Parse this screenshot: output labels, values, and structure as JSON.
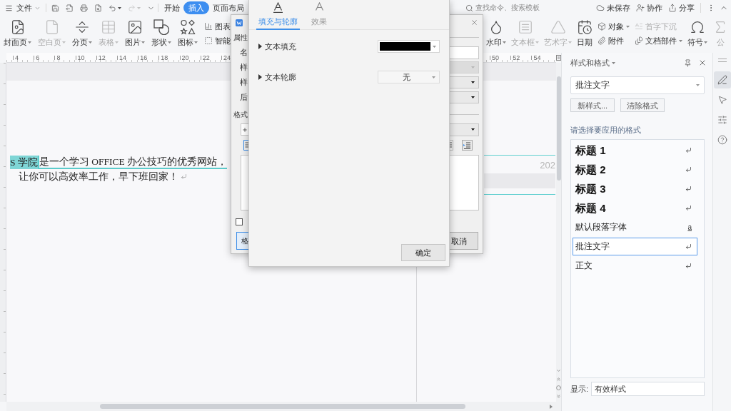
{
  "top_bar": {
    "file_menu": "文件",
    "quick_access": [
      {
        "disabled": false
      },
      {
        "disabled": false
      },
      {
        "disabled": false
      },
      {
        "disabled": false
      },
      {
        "disabled": false
      },
      {
        "disabled": true
      },
      {
        "disabled": false
      }
    ],
    "tabs": [
      {
        "label": "开始",
        "selected": false
      },
      {
        "label": "插入",
        "selected": true
      },
      {
        "label": "页面布局",
        "selected": false
      }
    ],
    "search_placeholder": "查找命令、搜索模板",
    "actions": [
      "未保存",
      "协作",
      "分享"
    ]
  },
  "ribbon": {
    "left": [
      {
        "kind": "large",
        "label": "封面页",
        "dropdown": true,
        "disabled": false
      },
      {
        "kind": "large",
        "label": "空白页",
        "dropdown": true,
        "disabled": true
      },
      {
        "kind": "large",
        "label": "分页",
        "dropdown": true,
        "disabled": false
      },
      {
        "kind": "large",
        "label": "表格",
        "dropdown": true,
        "disabled": true
      },
      {
        "kind": "large",
        "label": "图片",
        "dropdown": true,
        "disabled": false
      },
      {
        "kind": "large",
        "label": "形状",
        "dropdown": true,
        "disabled": false
      },
      {
        "kind": "large",
        "label": "图标",
        "dropdown": true,
        "disabled": false
      },
      {
        "kind": "stack",
        "items": [
          {
            "label": "图表",
            "dropdown": false,
            "disabled": false
          },
          {
            "label": "智能",
            "dropdown": false,
            "disabled": false
          }
        ]
      }
    ],
    "right": [
      {
        "kind": "large",
        "label": "水印",
        "dropdown": true,
        "disabled": false
      },
      {
        "kind": "large",
        "label": "文本框",
        "dropdown": true,
        "disabled": true
      },
      {
        "kind": "large",
        "label": "艺术字",
        "dropdown": true,
        "disabled": true
      },
      {
        "kind": "large",
        "label": "日期",
        "dropdown": false,
        "disabled": false
      },
      {
        "kind": "stack",
        "items": [
          {
            "label": "对象",
            "dropdown": true,
            "disabled": false
          },
          {
            "label": "附件",
            "dropdown": false,
            "disabled": false
          }
        ]
      },
      {
        "kind": "stack",
        "items": [
          {
            "label": "首字下沉",
            "dropdown": false,
            "disabled": true
          },
          {
            "label": "文档部件",
            "dropdown": true,
            "disabled": false
          }
        ]
      },
      {
        "kind": "large",
        "label": "符号",
        "dropdown": true,
        "disabled": false
      },
      {
        "kind": "large",
        "label": "公",
        "dropdown": false,
        "disabled": true
      }
    ]
  },
  "ruler": {
    "left_numbers": [
      "4",
      "6",
      "8",
      "10",
      "12",
      "14",
      "16",
      "18",
      "20",
      "22",
      "24"
    ],
    "right_numbers": [
      "50",
      "52",
      "54"
    ]
  },
  "document": {
    "lines": [
      {
        "segments": [
          {
            "text": "S 学院",
            "highlighted": true,
            "commented": false
          },
          {
            "text": "是一个学习 OFFICE 办公技巧的优秀网站，",
            "highlighted": false,
            "commented": true
          }
        ],
        "paragraph_end": false
      },
      {
        "segments": [
          {
            "text": "让你可以高效率工作，早下班回家！",
            "highlighted": false,
            "commented": false
          }
        ],
        "paragraph_end": true
      }
    ],
    "comment": {
      "date": "202"
    }
  },
  "style_dialog": {
    "rows": [
      {
        "kind": "section",
        "label": "属性"
      },
      {
        "kind": "input",
        "label": "名",
        "disabled": false
      },
      {
        "kind": "select",
        "label": "样",
        "disabled": true
      },
      {
        "kind": "select",
        "label": "样",
        "disabled": false
      },
      {
        "kind": "select",
        "label": "后",
        "disabled": false
      },
      {
        "kind": "section",
        "label": "格式"
      }
    ],
    "checkbox": {
      "checked": false
    },
    "format_button": "格",
    "cancel_button": "取消"
  },
  "text_effect_dialog": {
    "tabs": [
      {
        "label": "填充与轮廓",
        "selected": true
      },
      {
        "label": "效果",
        "selected": false
      }
    ],
    "rows": [
      {
        "kind": "color",
        "label": "文本填充",
        "expanded": false,
        "color": "#000000"
      },
      {
        "kind": "select",
        "label": "文本轮廓",
        "expanded": false,
        "value": "无"
      }
    ],
    "ok_button": "确定"
  },
  "styles_panel": {
    "title": "样式和格式",
    "current_style": "批注文字",
    "buttons": [
      "新样式...",
      "清除格式"
    ],
    "prompt": "请选择要应用的格式",
    "styles": [
      {
        "label": "标题 1",
        "kind": "heading",
        "selected": false
      },
      {
        "label": "标题 2",
        "kind": "heading",
        "selected": false
      },
      {
        "label": "标题 3",
        "kind": "heading",
        "selected": false
      },
      {
        "label": "标题 4",
        "kind": "heading",
        "selected": false
      },
      {
        "label": "默认段落字体",
        "kind": "character",
        "symbol": "a",
        "selected": false
      },
      {
        "label": "批注文字",
        "kind": "paragraph",
        "selected": true
      },
      {
        "label": "正文",
        "kind": "paragraph",
        "selected": false
      }
    ],
    "show_label": "显示:",
    "show_value": "有效样式"
  },
  "side_tools": [
    {
      "selected": true
    },
    {
      "selected": false
    },
    {
      "selected": false
    },
    {
      "selected": false
    }
  ]
}
